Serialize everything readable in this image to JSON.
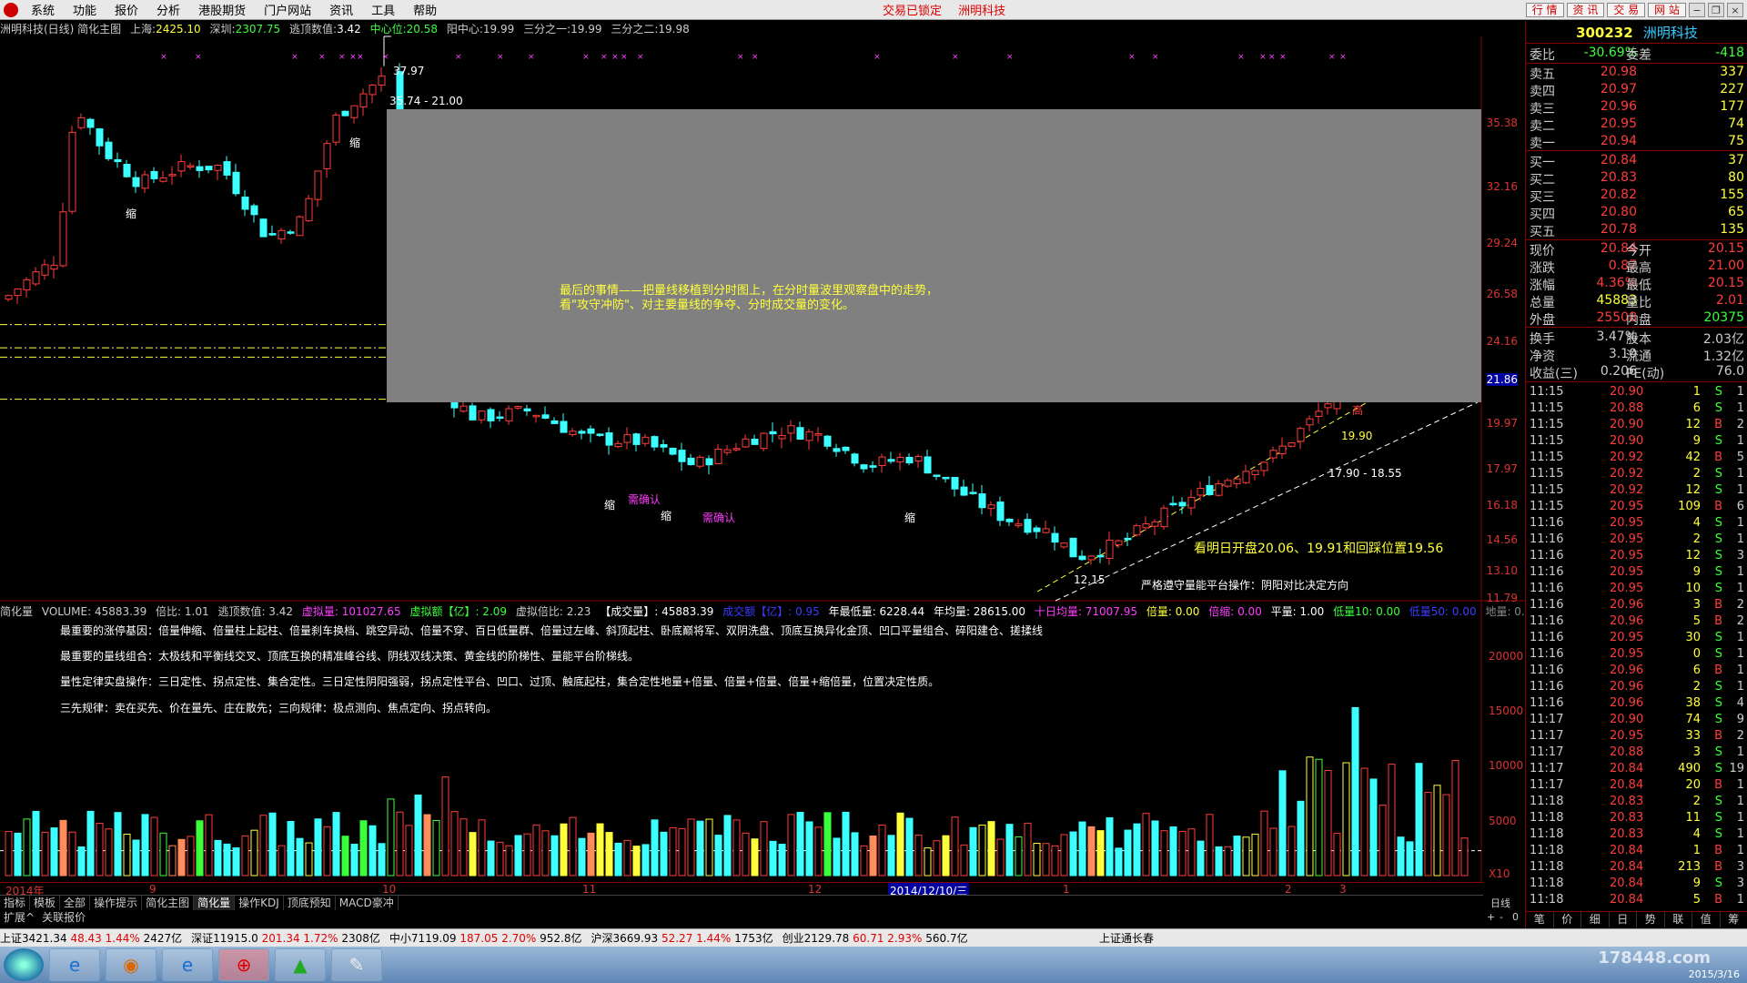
{
  "menubar": {
    "items": [
      "系统",
      "功能",
      "报价",
      "分析",
      "港股期货",
      "门户网站",
      "资讯",
      "工具",
      "帮助"
    ],
    "status_left": "交易已锁定",
    "status_right": "洲明科技",
    "right_buttons": [
      "行 情",
      "资 讯",
      "交 易",
      "网 站"
    ]
  },
  "chart_header": {
    "title": "洲明科技(日线) 简化主图",
    "sh_label": "上海:",
    "sh_value": "2425.10",
    "sz_label": "深圳:",
    "sz_value": "2307.75",
    "escape_label": "逃顶数值:",
    "escape_value": "3.42",
    "center_label": "中心位:",
    "center_value": "20.58",
    "yang_label": "阳中心:",
    "yang_value": "19.99",
    "third1_label": "三分之一:",
    "third1_value": "19.99",
    "third2_label": "三分之二:",
    "third2_value": "19.98"
  },
  "price_axis": [
    "35.38",
    "32.16",
    "29.24",
    "26.58",
    "24.16",
    "21.86",
    "19.97",
    "17.97",
    "16.18",
    "14.56",
    "13.10",
    "11.79"
  ],
  "price_cursor": "21.86",
  "chart_labels": {
    "high_label": "37.97",
    "range_label": "35.74 - 21.00",
    "suo1": "缩",
    "suo2": "缩",
    "suo3": "缩",
    "suo4": "缩",
    "suo5": "缩",
    "low_label": "12.15",
    "range2": "17.90 - 18.55",
    "c1": "19.90",
    "c2": "高",
    "outlook": "看明日开盘20.06、19.91和回踩位置19.56",
    "rule": "严格遵守量能平台操作：阴阳对比决定方向",
    "confirm1": "需确认",
    "confirm2": "需确认"
  },
  "overlay_note": "最后的事情——把量线移植到分时图上，在分时量波里观察盘中的走势，看\"攻守冲防\"、对主要量线的争夺、分时成交量的变化。",
  "vol_header": {
    "title": "简化量",
    "volume": "VOLUME: 45883.39",
    "ratio": "倍比: 1.01",
    "escape": "逃顶数值: 3.42",
    "virtual": "虚拟量: 101027.65",
    "virtual_amt": "虚拟额【亿】: 2.09",
    "virtual_ratio": "虚拟倍比: 2.23",
    "deal": "【成交量】: 45883.39",
    "deal_amt": "成交额【亿】: 0.95",
    "year_low": "年最低量: 6228.44",
    "year_avg": "年均量: 28615.00",
    "ten_avg": "十日均量: 71007.95",
    "double_vol": "倍量: 0.00",
    "double_shrink": "倍缩: 0.00",
    "flat": "平量: 1.00",
    "low10": "低量10: 0.00",
    "low50": "低量50: 0.00",
    "ground": "地量: 0.00"
  },
  "vol_notes": [
    "最重要的涨停基因：倍量伸缩、倍量柱上起柱、倍量刹车换档、跳空异动、倍量不穿、百日低量群、倍量过左峰、斜顶起柱、卧底巅将军、双阴洗盘、顶底互换异化金顶、凹口平量组合、碎阳建仓、搓揉线",
    "最重要的量线组合：太极线和平衡线交叉、顶底互换的精准峰谷线、阴线双线决策、黄金线的阶梯性、量能平台阶梯线。",
    "量性定律实盘操作：三日定性、拐点定性、集合定性。三日定性阴阳强弱，拐点定性平台、凹口、过顶、触底起柱，集合定性地量+倍量、倍量+倍量、倍量+缩倍量，位置决定性质。",
    "三先规律：卖在买先、价在量先、庄在散先；三向规律：极点测向、焦点定向、拐点转向。"
  ],
  "vol_axis": [
    "20000",
    "15000",
    "10000",
    "5000",
    "X10"
  ],
  "date_axis": {
    "year": "2014年",
    "m9": "9",
    "m10": "10",
    "m11": "11",
    "m12": "12",
    "cursor": "2014/12/10/三",
    "m1": "1",
    "m2": "2",
    "m3": "3"
  },
  "tabs1": [
    "指标",
    "模板",
    "全部",
    "操作提示",
    "简化主图",
    "简化量",
    "操作KDJ",
    "顶底预知",
    "MACD豪冲"
  ],
  "tabs1_active": "简化量",
  "tabs2": [
    "扩展^",
    "关联报价"
  ],
  "zoom": {
    "period": "日线",
    "plus": "+",
    "minus": "-",
    "zero": "0"
  },
  "quote": {
    "code": "300232",
    "name": "洲明科技",
    "weibi_label": "委比",
    "weibi_value": "-30.69%",
    "weicha_label": "委差",
    "weicha_value": "-418",
    "asks": [
      {
        "label": "卖五",
        "price": "20.98",
        "vol": "337"
      },
      {
        "label": "卖四",
        "price": "20.97",
        "vol": "227"
      },
      {
        "label": "卖三",
        "price": "20.96",
        "vol": "177"
      },
      {
        "label": "卖二",
        "price": "20.95",
        "vol": "74"
      },
      {
        "label": "卖一",
        "price": "20.94",
        "vol": "75"
      }
    ],
    "bids": [
      {
        "label": "买一",
        "price": "20.84",
        "vol": "37"
      },
      {
        "label": "买二",
        "price": "20.83",
        "vol": "80"
      },
      {
        "label": "买三",
        "price": "20.82",
        "vol": "155"
      },
      {
        "label": "买四",
        "price": "20.80",
        "vol": "65"
      },
      {
        "label": "买五",
        "price": "20.78",
        "vol": "135"
      }
    ],
    "stats": [
      {
        "l1": "现价",
        "v1": "20.84",
        "c1": "#ff3c3c",
        "l2": "今开",
        "v2": "20.15",
        "c2": "#ff3c3c"
      },
      {
        "l1": "涨跌",
        "v1": "0.87",
        "c1": "#ff3c3c",
        "l2": "最高",
        "v2": "21.00",
        "c2": "#ff3c3c"
      },
      {
        "l1": "涨幅",
        "v1": "4.36%",
        "c1": "#ff3c3c",
        "l2": "最低",
        "v2": "20.15",
        "c2": "#ff3c3c"
      },
      {
        "l1": "总量",
        "v1": "45883",
        "c1": "#ffff3c",
        "l2": "量比",
        "v2": "2.01",
        "c2": "#ff3c3c"
      },
      {
        "l1": "外盘",
        "v1": "25508",
        "c1": "#ff3c3c",
        "l2": "内盘",
        "v2": "20375",
        "c2": "#3cff3c"
      }
    ],
    "stats2": [
      {
        "l1": "换手",
        "v1": "3.47%",
        "l2": "股本",
        "v2": "2.03亿"
      },
      {
        "l1": "净资",
        "v1": "3.10",
        "l2": "流通",
        "v2": "1.32亿"
      },
      {
        "l1": "收益(三)",
        "v1": "0.206",
        "l2": "PE(动)",
        "v2": "76.0"
      }
    ],
    "ticks": [
      {
        "t": "11:15",
        "p": "20.90",
        "v": "1",
        "bs": "S",
        "n": "1"
      },
      {
        "t": "11:15",
        "p": "20.88",
        "v": "6",
        "bs": "S",
        "n": "1"
      },
      {
        "t": "11:15",
        "p": "20.90",
        "v": "12",
        "bs": "B",
        "n": "2"
      },
      {
        "t": "11:15",
        "p": "20.90",
        "v": "9",
        "bs": "S",
        "n": "1"
      },
      {
        "t": "11:15",
        "p": "20.92",
        "v": "42",
        "bs": "B",
        "n": "5"
      },
      {
        "t": "11:15",
        "p": "20.92",
        "v": "2",
        "bs": "S",
        "n": "1"
      },
      {
        "t": "11:15",
        "p": "20.92",
        "v": "12",
        "bs": "S",
        "n": "1"
      },
      {
        "t": "11:15",
        "p": "20.95",
        "v": "109",
        "bs": "B",
        "n": "6"
      },
      {
        "t": "11:16",
        "p": "20.95",
        "v": "4",
        "bs": "S",
        "n": "1"
      },
      {
        "t": "11:16",
        "p": "20.95",
        "v": "2",
        "bs": "S",
        "n": "1"
      },
      {
        "t": "11:16",
        "p": "20.95",
        "v": "12",
        "bs": "S",
        "n": "3"
      },
      {
        "t": "11:16",
        "p": "20.95",
        "v": "9",
        "bs": "S",
        "n": "1"
      },
      {
        "t": "11:16",
        "p": "20.95",
        "v": "10",
        "bs": "S",
        "n": "1"
      },
      {
        "t": "11:16",
        "p": "20.96",
        "v": "3",
        "bs": "B",
        "n": "2"
      },
      {
        "t": "11:16",
        "p": "20.96",
        "v": "5",
        "bs": "B",
        "n": "2"
      },
      {
        "t": "11:16",
        "p": "20.95",
        "v": "30",
        "bs": "S",
        "n": "1"
      },
      {
        "t": "11:16",
        "p": "20.95",
        "v": "0",
        "bs": "S",
        "n": "1"
      },
      {
        "t": "11:16",
        "p": "20.96",
        "v": "6",
        "bs": "B",
        "n": "1"
      },
      {
        "t": "11:16",
        "p": "20.96",
        "v": "2",
        "bs": "S",
        "n": "1"
      },
      {
        "t": "11:16",
        "p": "20.96",
        "v": "38",
        "bs": "S",
        "n": "4"
      },
      {
        "t": "11:17",
        "p": "20.90",
        "v": "74",
        "bs": "S",
        "n": "9"
      },
      {
        "t": "11:17",
        "p": "20.95",
        "v": "33",
        "bs": "B",
        "n": "2"
      },
      {
        "t": "11:17",
        "p": "20.88",
        "v": "3",
        "bs": "S",
        "n": "1"
      },
      {
        "t": "11:17",
        "p": "20.84",
        "v": "490",
        "bs": "S",
        "n": "19"
      },
      {
        "t": "11:17",
        "p": "20.84",
        "v": "20",
        "bs": "B",
        "n": "1"
      },
      {
        "t": "11:18",
        "p": "20.83",
        "v": "2",
        "bs": "S",
        "n": "1"
      },
      {
        "t": "11:18",
        "p": "20.83",
        "v": "11",
        "bs": "S",
        "n": "1"
      },
      {
        "t": "11:18",
        "p": "20.83",
        "v": "4",
        "bs": "S",
        "n": "1"
      },
      {
        "t": "11:18",
        "p": "20.84",
        "v": "1",
        "bs": "B",
        "n": "1"
      },
      {
        "t": "11:18",
        "p": "20.84",
        "v": "213",
        "bs": "B",
        "n": "3"
      },
      {
        "t": "11:18",
        "p": "20.84",
        "v": "9",
        "bs": "S",
        "n": "3"
      },
      {
        "t": "11:18",
        "p": "20.84",
        "v": "5",
        "bs": "B",
        "n": "1"
      }
    ],
    "tabs": [
      "笔",
      "价",
      "细",
      "日",
      "势",
      "联",
      "值",
      "筹"
    ]
  },
  "status_bar": {
    "sh": "上证3421.34",
    "sh_chg": "48.43",
    "sh_pct": "1.44%",
    "sh_amt": "2427亿",
    "sz": "深证11915.0",
    "sz_chg": "201.34",
    "sz_pct": "1.72%",
    "sz_amt": "2308亿",
    "zx": "中小7119.09",
    "zx_chg": "187.05",
    "zx_pct": "2.70%",
    "zx_amt": "952.8亿",
    "hs": "沪深3669.93",
    "hs_chg": "52.27",
    "hs_pct": "1.44%",
    "hs_amt": "1753亿",
    "cy": "创业2129.78",
    "cy_chg": "60.71",
    "cy_pct": "2.93%",
    "cy_amt": "560.7亿",
    "tail": "上证通长春"
  },
  "taskbar": {
    "watermark": "178448.com",
    "date": "2015/3/16"
  },
  "colors": {
    "up": "#ff3c3c",
    "down": "#3cffff",
    "gray_box": "#808080",
    "note": "#ffff3c"
  },
  "chart_data": {
    "type": "candlestick",
    "title": "洲明科技(日线)",
    "xlabel": "",
    "ylabel": "",
    "ylim": [
      11.79,
      37.97
    ],
    "log_scale": true,
    "price_hlines": [
      20.58,
      19.99,
      19.98
    ],
    "high": 37.97,
    "low": 12.15,
    "volume_ylim": [
      0,
      22000
    ],
    "volume_unit_label": "X10"
  }
}
